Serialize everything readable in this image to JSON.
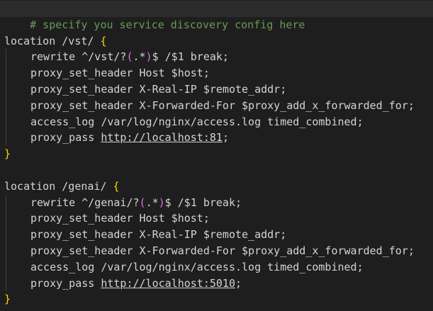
{
  "editor": {
    "comment": "# specify you service discovery config here",
    "blocks": [
      {
        "location_keyword": "location",
        "location_path": " /vst/ ",
        "open_brace": "{",
        "rewrite_prefix": "rewrite ^/vst/?",
        "rewrite_group_open": "(",
        "rewrite_group_body": ".*",
        "rewrite_group_close": ")",
        "rewrite_suffix": "$ /$1 break;",
        "header_host": "proxy_set_header Host $host;",
        "header_real_ip": "proxy_set_header X-Real-IP $remote_addr;",
        "header_forwarded": "proxy_set_header X-Forwarded-For $proxy_add_x_forwarded_for;",
        "access_log": "access_log /var/log/nginx/access.log timed_combined;",
        "proxy_pass_label": "proxy_pass ",
        "proxy_pass_url": "http://localhost:81",
        "proxy_pass_end": ";",
        "close_brace": "}"
      },
      {
        "location_keyword": "location",
        "location_path": " /genai/ ",
        "open_brace": "{",
        "rewrite_prefix": "rewrite ^/genai/?",
        "rewrite_group_open": "(",
        "rewrite_group_body": ".*",
        "rewrite_group_close": ")",
        "rewrite_suffix": "$ /$1 break;",
        "header_host": "proxy_set_header Host $host;",
        "header_real_ip": "proxy_set_header X-Real-IP $remote_addr;",
        "header_forwarded": "proxy_set_header X-Forwarded-For $proxy_add_x_forwarded_for;",
        "access_log": "access_log /var/log/nginx/access.log timed_combined;",
        "proxy_pass_label": "proxy_pass ",
        "proxy_pass_url": "http://localhost:5010",
        "proxy_pass_end": ";",
        "close_brace": "}"
      }
    ]
  }
}
